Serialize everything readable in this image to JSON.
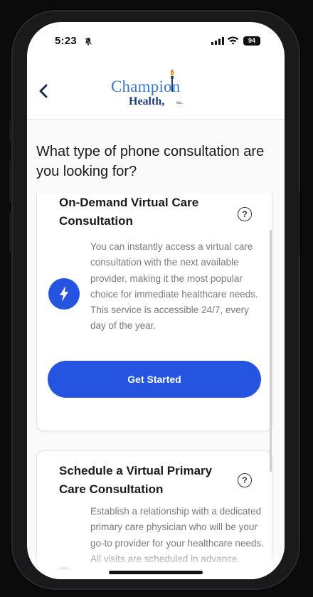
{
  "status_bar": {
    "time": "5:23",
    "battery": "94"
  },
  "header": {
    "logo_top": "Champion",
    "logo_bottom": "Health,",
    "logo_suffix": "Inc."
  },
  "question": "What type of phone consultation are you looking for?",
  "cards": [
    {
      "title": "On-Demand Virtual Care Consultation",
      "description": "You can instantly access a virtual care consultation with the next available provider, making it the most popular choice for immediate healthcare needs. This service is accessible 24/7, every day of the year.",
      "button_label": "Get Started",
      "icon": "lightning-bolt-icon"
    },
    {
      "title": "Schedule a Virtual Primary Care Consultation",
      "description": "Establish a relationship with a dedicated primary care physician who will be your go-to provider for your healthcare needs. All visits are scheduled in advance.",
      "icon": "calendar-icon"
    }
  ],
  "colors": {
    "primary": "#2454e0",
    "logo_blue": "#3a78c8",
    "logo_navy": "#1f3d79"
  }
}
